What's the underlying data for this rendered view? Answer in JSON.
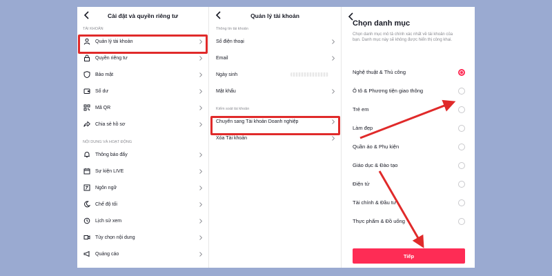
{
  "colors": {
    "background": "#9aaad1",
    "highlight": "#e02a2a",
    "accent": "#fe2c55"
  },
  "panel1": {
    "title": "Cài đặt và quyền riêng tư",
    "section_account": "TÀI KHOẢN",
    "account_items": [
      {
        "label": "Quản lý tài khoản",
        "icon": "person-icon"
      },
      {
        "label": "Quyền riêng tư",
        "icon": "lock-icon"
      },
      {
        "label": "Bảo mật",
        "icon": "shield-icon"
      },
      {
        "label": "Số dư",
        "icon": "wallet-icon"
      },
      {
        "label": "Mã QR",
        "icon": "qr-code-icon"
      },
      {
        "label": "Chia sẻ hồ sơ",
        "icon": "share-icon"
      }
    ],
    "section_content": "NỘI DUNG VÀ HOẠT ĐỘNG",
    "content_items": [
      {
        "label": "Thông báo đẩy",
        "icon": "bell-icon"
      },
      {
        "label": "Sự kiện LIVE",
        "icon": "calendar-icon"
      },
      {
        "label": "Ngôn ngữ",
        "icon": "language-icon"
      },
      {
        "label": "Chế độ tối",
        "icon": "moon-icon"
      },
      {
        "label": "Lịch sử xem",
        "icon": "history-icon"
      },
      {
        "label": "Tùy chọn nội dung",
        "icon": "video-icon"
      },
      {
        "label": "Quảng cáo",
        "icon": "megaphone-icon"
      }
    ]
  },
  "panel2": {
    "title": "Quản lý tài khoản",
    "section_info": "Thông tin tài khoản",
    "info_items": [
      {
        "label": "Số điện thoại"
      },
      {
        "label": "Email"
      },
      {
        "label": "Ngày sinh"
      },
      {
        "label": "Mật khẩu"
      }
    ],
    "section_control": "Kiểm soát tài khoản",
    "control_items": [
      {
        "label": "Chuyển sang Tài khoản Doanh nghiệp"
      },
      {
        "label": "Xóa Tài khoản"
      }
    ]
  },
  "panel3": {
    "title": "Chọn danh mục",
    "description": "Chọn danh mục mô tả chính xác nhất về tài khoản của bạn. Danh mục này sẽ không được hiển thị công khai.",
    "selected_category": "Nghệ thuật & Thủ công",
    "categories": [
      "Nghệ thuật & Thủ công",
      "Ô tô & Phương tiện giao thông",
      "Trẻ em",
      "Làm đẹp",
      "Quần áo & Phụ kiện",
      "Giáo dục & Đào tạo",
      "Điện tử",
      "Tài chính & Đầu tư",
      "Thực phẩm & Đồ uống"
    ],
    "next_button": "Tiếp"
  }
}
